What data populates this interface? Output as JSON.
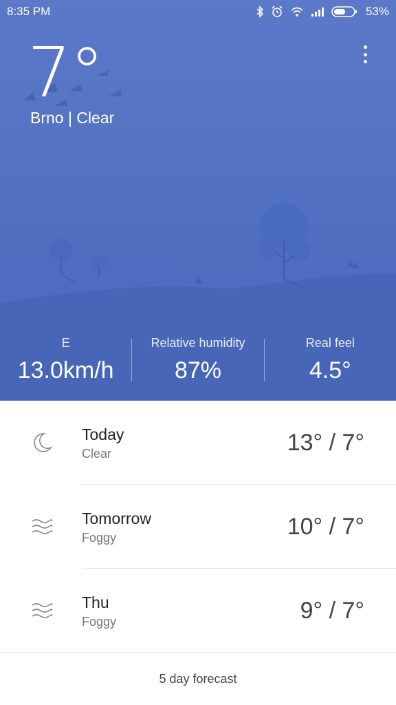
{
  "status_bar": {
    "time": "8:35 PM",
    "battery_percent": "53%",
    "icons": [
      "bluetooth-icon",
      "alarm-icon",
      "wifi-icon",
      "signal-icon",
      "battery-icon"
    ]
  },
  "weather": {
    "current_temp": "7°",
    "location": "Brno | Clear"
  },
  "stats": [
    {
      "label": "E",
      "value": "13.0km/h"
    },
    {
      "label": "Relative humidity",
      "value": "87%"
    },
    {
      "label": "Real feel",
      "value": "4.5°"
    }
  ],
  "forecast": [
    {
      "day": "Today",
      "condition": "Clear",
      "temps": "13° / 7°",
      "icon": "moon-icon"
    },
    {
      "day": "Tomorrow",
      "condition": "Foggy",
      "temps": "10° / 7°",
      "icon": "fog-icon"
    },
    {
      "day": "Thu",
      "condition": "Foggy",
      "temps": "9° / 7°",
      "icon": "fog-icon"
    }
  ],
  "footer": {
    "five_day_label": "5 day forecast"
  },
  "colors": {
    "hero_top": "#5b79c8",
    "hero_bottom": "#4a67bb",
    "hill_back": "#4f6cc0",
    "hill_front": "#4866b8",
    "tree": "#4a68bd"
  }
}
